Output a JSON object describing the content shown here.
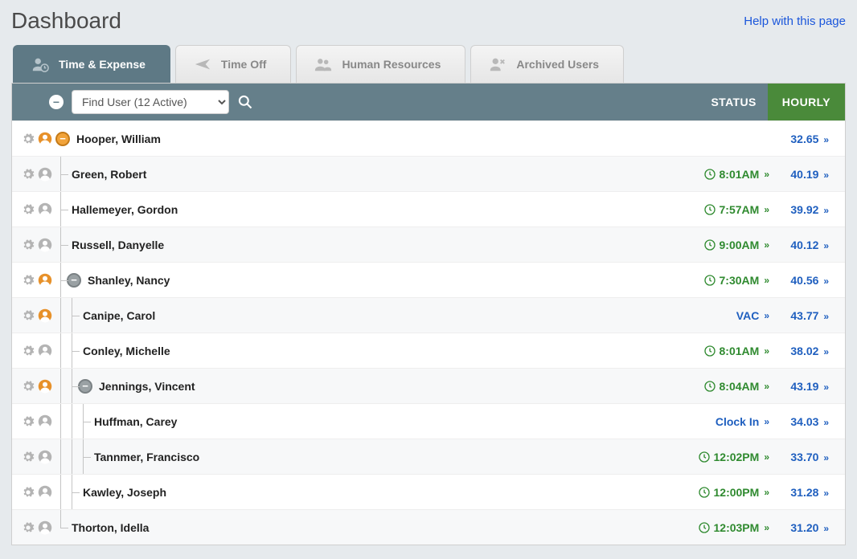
{
  "header": {
    "title": "Dashboard",
    "help": "Help with this page"
  },
  "tabs": [
    {
      "id": "time-expense",
      "label": "Time & Expense",
      "active": true
    },
    {
      "id": "time-off",
      "label": "Time Off"
    },
    {
      "id": "hr",
      "label": "Human Resources"
    },
    {
      "id": "archived",
      "label": "Archived Users"
    }
  ],
  "toolbar": {
    "collapse_glyph": "−",
    "find_user_placeholder": "Find User (12 Active)",
    "columns": {
      "status": "STATUS",
      "hourly": "HOURLY"
    }
  },
  "rows": [
    {
      "name": "Hooper, William",
      "depth": 0,
      "toggle": "orange",
      "person": "orange",
      "status_kind": "none",
      "status_text": "",
      "hourly": "32.65",
      "last_at_depth": [
        false
      ]
    },
    {
      "name": "Green, Robert",
      "depth": 1,
      "toggle": null,
      "person": "gray",
      "status_kind": "time",
      "status_text": "8:01AM",
      "hourly": "40.19",
      "last_at_depth": [
        false,
        false
      ]
    },
    {
      "name": "Hallemeyer, Gordon",
      "depth": 1,
      "toggle": null,
      "person": "gray",
      "status_kind": "time",
      "status_text": "7:57AM",
      "hourly": "39.92",
      "last_at_depth": [
        false,
        false
      ]
    },
    {
      "name": "Russell, Danyelle",
      "depth": 1,
      "toggle": null,
      "person": "gray",
      "status_kind": "time",
      "status_text": "9:00AM",
      "hourly": "40.12",
      "last_at_depth": [
        false,
        false
      ]
    },
    {
      "name": "Shanley, Nancy",
      "depth": 1,
      "toggle": "gray",
      "person": "orange",
      "status_kind": "time",
      "status_text": "7:30AM",
      "hourly": "40.56",
      "last_at_depth": [
        false,
        false
      ]
    },
    {
      "name": "Canipe, Carol",
      "depth": 2,
      "toggle": null,
      "person": "orange",
      "status_kind": "link",
      "status_text": "VAC",
      "hourly": "43.77",
      "last_at_depth": [
        false,
        false,
        false
      ]
    },
    {
      "name": "Conley, Michelle",
      "depth": 2,
      "toggle": null,
      "person": "gray",
      "status_kind": "time",
      "status_text": "8:01AM",
      "hourly": "38.02",
      "last_at_depth": [
        false,
        false,
        false
      ]
    },
    {
      "name": "Jennings, Vincent",
      "depth": 2,
      "toggle": "gray",
      "person": "orange",
      "status_kind": "time",
      "status_text": "8:04AM",
      "hourly": "43.19",
      "last_at_depth": [
        false,
        false,
        false
      ]
    },
    {
      "name": "Huffman, Carey",
      "depth": 3,
      "toggle": null,
      "person": "gray",
      "status_kind": "link",
      "status_text": "Clock In",
      "hourly": "34.03",
      "last_at_depth": [
        false,
        false,
        false,
        false
      ]
    },
    {
      "name": "Tannmer, Francisco",
      "depth": 3,
      "toggle": null,
      "person": "gray",
      "status_kind": "time",
      "status_text": "12:02PM",
      "hourly": "33.70",
      "last_at_depth": [
        false,
        false,
        false,
        true
      ]
    },
    {
      "name": "Kawley, Joseph",
      "depth": 2,
      "toggle": null,
      "person": "gray",
      "status_kind": "time",
      "status_text": "12:00PM",
      "hourly": "31.28",
      "last_at_depth": [
        false,
        false,
        true
      ]
    },
    {
      "name": "Thorton, Idella",
      "depth": 1,
      "toggle": null,
      "person": "gray",
      "status_kind": "time",
      "status_text": "12:03PM",
      "hourly": "31.20",
      "last_at_depth": [
        true,
        true
      ]
    }
  ]
}
